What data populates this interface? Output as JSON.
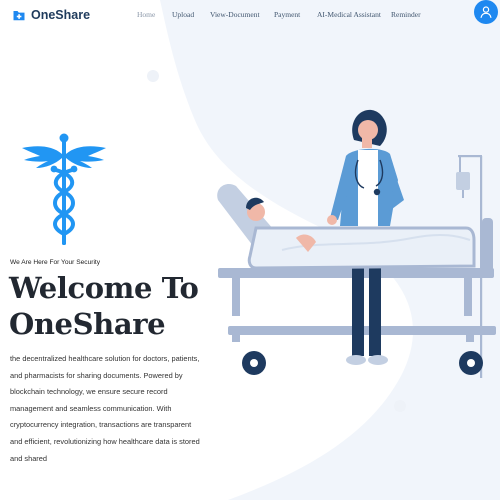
{
  "brand": {
    "name": "OneShare",
    "icon": "medical-folder-icon"
  },
  "nav": {
    "items": [
      {
        "label": "Home",
        "active": true
      },
      {
        "label": "Upload",
        "active": false
      },
      {
        "label": "View-Document",
        "active": false
      },
      {
        "label": "Payment",
        "active": false
      },
      {
        "label": "AI-Medical Assistant",
        "active": false
      },
      {
        "label": "Reminder",
        "active": false
      }
    ],
    "profile_icon": "user-icon"
  },
  "hero": {
    "symbol_icon": "caduceus-icon",
    "eyebrow": "We Are Here For Your Security",
    "title_line1": "Welcome To",
    "title_line2": "OneShare",
    "description": "the decentralized healthcare solution for doctors, patients, and pharmacists for sharing documents. Powered by blockchain technology, we ensure secure record management and seamless communication. With cryptocurrency integration, transactions are transparent and efficient, revolutionizing how healthcare data is stored and shared"
  },
  "illustration": {
    "icon": "doctor-and-patient-illustration"
  },
  "colors": {
    "accent": "#1e88f0",
    "brand_text": "#1f3b5c",
    "background_blob": "#f1f5fb",
    "caduceus": "#2196f3",
    "bed": "#a9b8d3"
  }
}
